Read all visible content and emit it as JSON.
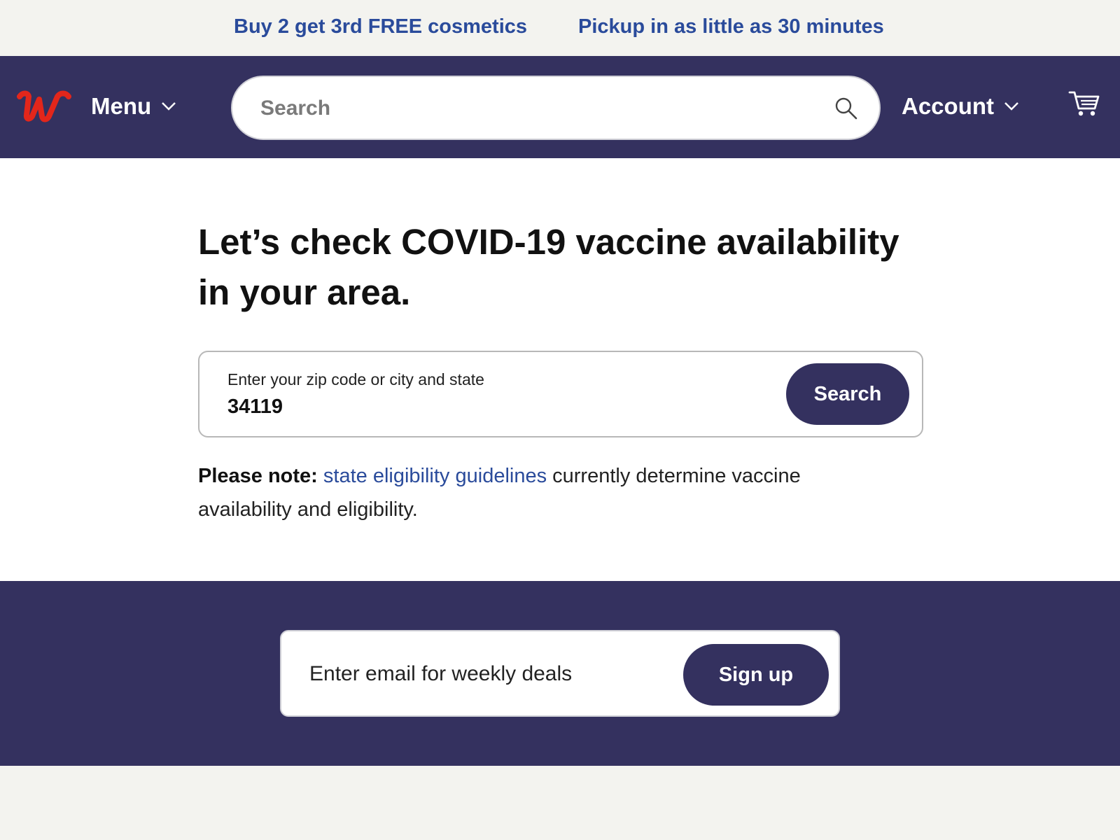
{
  "promo": {
    "items": [
      "Buy 2 get 3rd FREE cosmetics",
      "Pickup in as little as 30 minutes"
    ]
  },
  "header": {
    "menu_label": "Menu",
    "search_placeholder": "Search",
    "account_label": "Account",
    "icons": {
      "logo": "walgreens-w-logo",
      "menu_chevron": "chevron-down-icon",
      "search": "search-icon",
      "account_chevron": "chevron-down-icon",
      "cart": "cart-icon"
    }
  },
  "main": {
    "title": "Let’s check COVID-19 vaccine availability in your area.",
    "zip": {
      "label": "Enter your zip code or city and state",
      "value": "34119",
      "button_label": "Search"
    },
    "note": {
      "lead": "Please note:",
      "link_text": "state eligibility guidelines",
      "rest": " currently determine vaccine availability and eligibility."
    }
  },
  "newsletter": {
    "email_placeholder": "Enter email for weekly deals",
    "button_label": "Sign up"
  },
  "colors": {
    "navy": "#34315f",
    "link_blue": "#2a4b9b",
    "logo_red": "#e3261b",
    "page_bg": "#f3f3ef"
  }
}
